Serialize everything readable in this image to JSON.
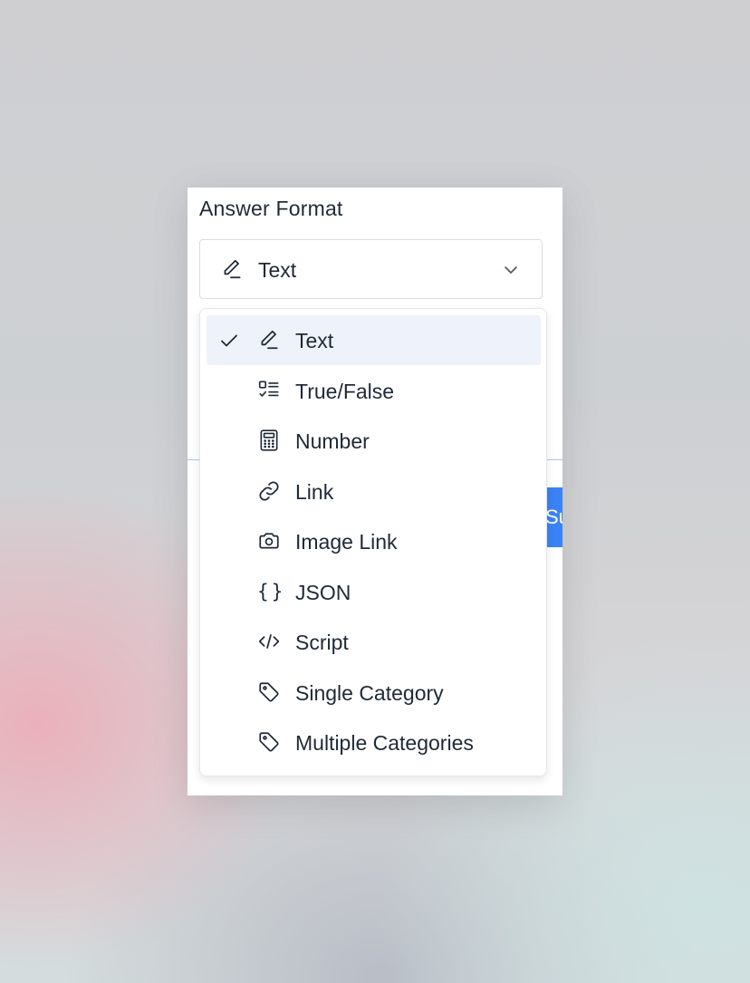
{
  "panel": {
    "title": "Answer Format"
  },
  "select": {
    "value": "Text",
    "icon": "pencil-icon"
  },
  "background_button": {
    "partial_label": "Su"
  },
  "dropdown": {
    "selected_index": 0,
    "options": [
      {
        "label": "Text",
        "icon": "pencil-icon"
      },
      {
        "label": "True/False",
        "icon": "checklist-icon"
      },
      {
        "label": "Number",
        "icon": "calculator-icon"
      },
      {
        "label": "Link",
        "icon": "link-icon"
      },
      {
        "label": "Image Link",
        "icon": "camera-icon"
      },
      {
        "label": "JSON",
        "icon": "braces-icon"
      },
      {
        "label": "Script",
        "icon": "code-icon"
      },
      {
        "label": "Single Category",
        "icon": "tag-icon"
      },
      {
        "label": "Multiple Categories",
        "icon": "tag-icon"
      }
    ]
  },
  "colors": {
    "accent": "#3b82f6",
    "selected_bg": "#eef2fa",
    "text": "#1f2937"
  }
}
